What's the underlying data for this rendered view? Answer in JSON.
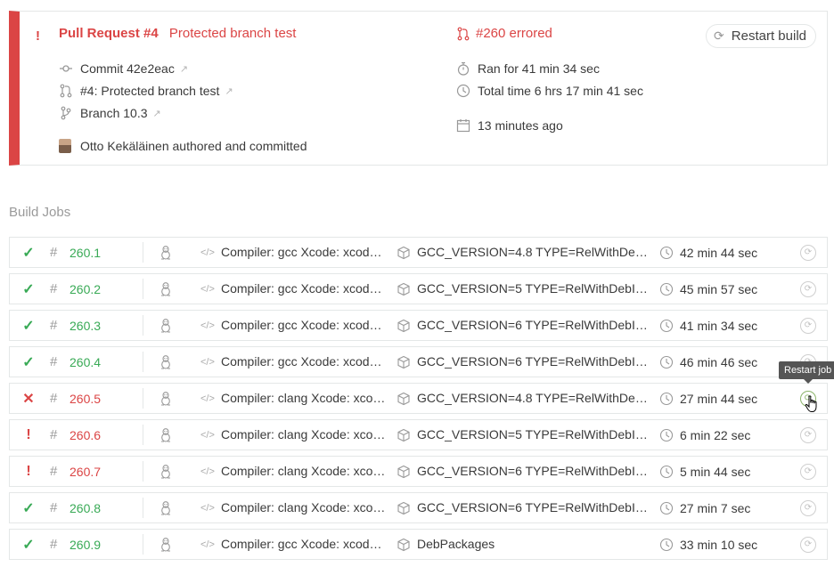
{
  "build": {
    "status_glyph": "!",
    "pr_label": "Pull Request #4",
    "pr_title": "Protected branch test",
    "commit": "Commit 42e2eac",
    "pr_link": "#4: Protected branch test",
    "branch": "Branch 10.3",
    "author": "Otto Kekäläinen authored and committed",
    "build_state": "#260 errored",
    "ran_for": "Ran for 41 min 34 sec",
    "total_time": "Total time 6 hrs 17 min 41 sec",
    "when": "13 minutes ago",
    "restart_label": "Restart build",
    "status_color": "#db4545"
  },
  "section_title": "Build Jobs",
  "tooltip": "Restart job",
  "jobs": [
    {
      "state": "passed",
      "glyph": "✓",
      "num": "260.1",
      "compiler": "Compiler: gcc Xcode: xcode…",
      "env": "GCC_VERSION=4.8 TYPE=RelWithDebInf…",
      "duration": "42 min 44 sec"
    },
    {
      "state": "passed",
      "glyph": "✓",
      "num": "260.2",
      "compiler": "Compiler: gcc Xcode: xcode…",
      "env": "GCC_VERSION=5 TYPE=RelWithDebInfo …",
      "duration": "45 min 57 sec"
    },
    {
      "state": "passed",
      "glyph": "✓",
      "num": "260.3",
      "compiler": "Compiler: gcc Xcode: xcode…",
      "env": "GCC_VERSION=6 TYPE=RelWithDebInfo …",
      "duration": "41 min 34 sec"
    },
    {
      "state": "passed",
      "glyph": "✓",
      "num": "260.4",
      "compiler": "Compiler: gcc Xcode: xcode…",
      "env": "GCC_VERSION=6 TYPE=RelWithDebInfo …",
      "duration": "46 min 46 sec"
    },
    {
      "state": "failed",
      "glyph": "✕",
      "num": "260.5",
      "compiler": "Compiler: clang Xcode: xco…",
      "env": "GCC_VERSION=4.8 TYPE=RelWithDebInf…",
      "duration": "27 min 44 sec"
    },
    {
      "state": "errored",
      "glyph": "!",
      "num": "260.6",
      "compiler": "Compiler: clang Xcode: xco…",
      "env": "GCC_VERSION=5 TYPE=RelWithDebInfo …",
      "duration": "6 min 22 sec"
    },
    {
      "state": "errored",
      "glyph": "!",
      "num": "260.7",
      "compiler": "Compiler: clang Xcode: xco…",
      "env": "GCC_VERSION=6 TYPE=RelWithDebInfo …",
      "duration": "5 min 44 sec"
    },
    {
      "state": "passed",
      "glyph": "✓",
      "num": "260.8",
      "compiler": "Compiler: clang Xcode: xco…",
      "env": "GCC_VERSION=6 TYPE=RelWithDebInfo …",
      "duration": "27 min 7 sec"
    },
    {
      "state": "passed",
      "glyph": "✓",
      "num": "260.9",
      "compiler": "Compiler: gcc Xcode: xcode…",
      "env": "DebPackages",
      "duration": "33 min 10 sec"
    }
  ],
  "icons": {
    "os": "linux-tux-icon",
    "code": "code-icon",
    "env": "package-box-icon",
    "duration": "clock-icon",
    "restart": "restart-icon"
  }
}
